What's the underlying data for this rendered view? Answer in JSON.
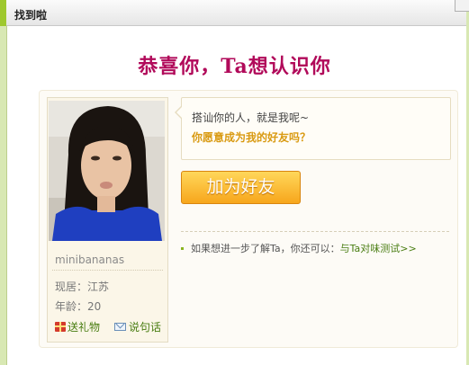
{
  "dialog": {
    "title": "找到啦"
  },
  "headline": "恭喜你，Ta想认识你",
  "profile": {
    "username": "minibananas",
    "residence": "现居：江苏",
    "age": "年龄：20",
    "gift_label": "送礼物",
    "message_label": "说句话"
  },
  "bubble": {
    "line1": "搭讪你的人，就是我呢~",
    "line2": "你愿意成为我的好友吗？"
  },
  "actions": {
    "add_friend_label": "加为好友"
  },
  "tip": {
    "text": "如果想进一步了解Ta，你还可以：",
    "link_label": "与Ta对味测试>>"
  },
  "colors": {
    "headline": "#b10a5a",
    "accent_green": "#497d12",
    "button_orange": "#f7a61c",
    "emphasis_gold": "#d99a12"
  }
}
